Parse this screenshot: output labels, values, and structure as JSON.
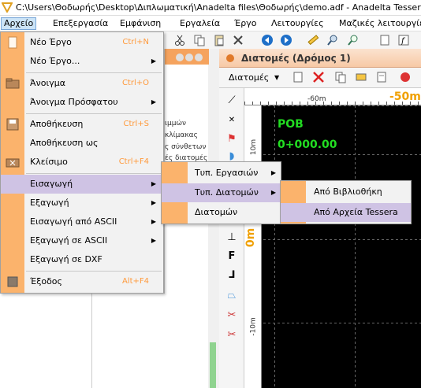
{
  "titlebar": {
    "title": "C:\\Users\\Θοδωρής\\Desktop\\Διπλωματική\\Anadelta files\\Θοδωρής\\demo.adf - Anadelta Tessera"
  },
  "menubar": {
    "items": [
      "Αρχείο",
      "Επεξεργασία",
      "Εμφάνιση",
      "Εργαλεία",
      "Έργο",
      "Λειτουργίες",
      "Μαζικές λειτουργίε"
    ]
  },
  "left_panel": {
    "lines": [
      "ιμμών",
      "κλίμακας",
      "ς σύνθετων",
      "ές διατομές"
    ]
  },
  "section_window": {
    "title": "Διατομές (Δρόμος 1)",
    "dropdown": "Διατομές"
  },
  "canvas": {
    "ruler_left": "-60m",
    "ruler_right": "-50m",
    "vruler_top": "10m",
    "vruler_mid": "0m",
    "vruler_bot": "-10m",
    "pob_label": "POB",
    "station": "0+000.00"
  },
  "file_menu": {
    "items": [
      {
        "label": "Νέο Έργο",
        "shortcut": "Ctrl+N",
        "icon": "new-project-icon"
      },
      {
        "label": "Νέο Έργο...",
        "arrow": "▶"
      },
      {
        "label": "Άνοιγμα",
        "shortcut": "Ctrl+O",
        "icon": "open-folder-icon"
      },
      {
        "label": "Άνοιγμα Πρόσφατου",
        "arrow": "▶"
      },
      {
        "label": "Αποθήκευση",
        "shortcut": "Ctrl+S",
        "icon": "save-icon"
      },
      {
        "label": "Αποθήκευση ως"
      },
      {
        "label": "Κλείσιμο",
        "shortcut": "Ctrl+F4",
        "icon": "close-project-icon"
      },
      {
        "label": "Εισαγωγή",
        "arrow": "▶"
      },
      {
        "label": "Εξαγωγή",
        "arrow": "▶"
      },
      {
        "label": "Εισαγωγή από ASCII",
        "arrow": "▶"
      },
      {
        "label": "Εξαγωγή σε ASCII",
        "arrow": "▶"
      },
      {
        "label": "Εξαγωγή σε DXF"
      },
      {
        "label": "Έξοδος",
        "shortcut": "Alt+F4",
        "icon": "exit-icon"
      }
    ]
  },
  "import_submenu": {
    "items": [
      {
        "label": "Τυπ. Εργασιών",
        "arrow": "▶"
      },
      {
        "label": "Τυπ. Διατομών",
        "arrow": "▶"
      },
      {
        "label": "Διατομών"
      }
    ]
  },
  "typical_sections_submenu": {
    "items": [
      {
        "label": "Από Βιβλιοθήκη"
      },
      {
        "label": "Από Αρχεία Tessera"
      }
    ]
  },
  "colors": {
    "accent_orange": "#fbb36c",
    "highlight": "#cfc3e4",
    "canvas_bg": "#000000",
    "green_text": "#22dd22",
    "ruler_label": "#f0a000"
  }
}
